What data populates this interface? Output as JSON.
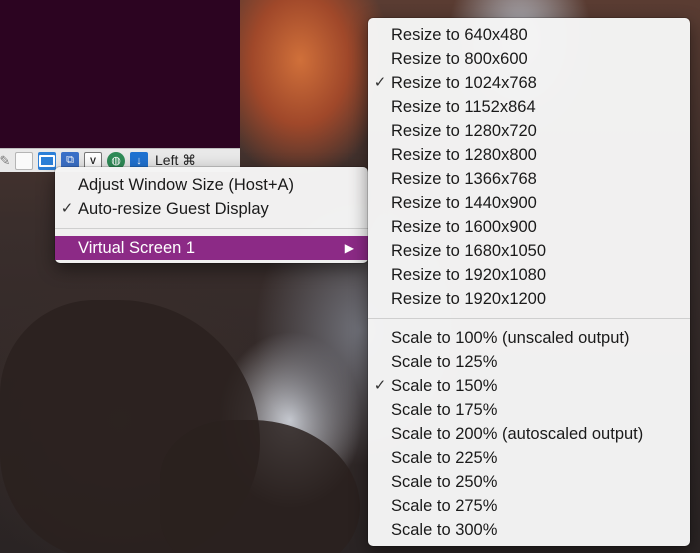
{
  "statusbar": {
    "host_key_text": "Left ⌘",
    "icons": [
      "pencil-icon",
      "blank-disk-icon",
      "screen-icon",
      "network-icon",
      "video-capture-icon",
      "globe-icon",
      "download-icon"
    ],
    "video_icon_text": "V"
  },
  "view_menu": {
    "items": [
      {
        "label": "Adjust Window Size (Host+A)",
        "checked": false
      },
      {
        "label": "Auto-resize Guest Display",
        "checked": true
      },
      {
        "label": "Virtual Screen 1",
        "highlighted": true,
        "has_submenu": true
      }
    ],
    "submenu_arrow": "▶",
    "highlight_color": "#8c2a86"
  },
  "virtual_screen_submenu": {
    "resize_items": [
      {
        "label": "Resize to 640x480",
        "checked": false
      },
      {
        "label": "Resize to 800x600",
        "checked": false
      },
      {
        "label": "Resize to 1024x768",
        "checked": true
      },
      {
        "label": "Resize to 1152x864",
        "checked": false
      },
      {
        "label": "Resize to 1280x720",
        "checked": false
      },
      {
        "label": "Resize to 1280x800",
        "checked": false
      },
      {
        "label": "Resize to 1366x768",
        "checked": false
      },
      {
        "label": "Resize to 1440x900",
        "checked": false
      },
      {
        "label": "Resize to 1600x900",
        "checked": false
      },
      {
        "label": "Resize to 1680x1050",
        "checked": false
      },
      {
        "label": "Resize to 1920x1080",
        "checked": false
      },
      {
        "label": "Resize to 1920x1200",
        "checked": false
      }
    ],
    "scale_items": [
      {
        "label": "Scale to 100% (unscaled output)",
        "checked": false
      },
      {
        "label": "Scale to 125%",
        "checked": false
      },
      {
        "label": "Scale to 150%",
        "checked": true
      },
      {
        "label": "Scale to 175%",
        "checked": false
      },
      {
        "label": "Scale to 200% (autoscaled output)",
        "checked": false
      },
      {
        "label": "Scale to 225%",
        "checked": false
      },
      {
        "label": "Scale to 250%",
        "checked": false
      },
      {
        "label": "Scale to 275%",
        "checked": false
      },
      {
        "label": "Scale to 300%",
        "checked": false
      }
    ],
    "check_mark": "✓"
  }
}
